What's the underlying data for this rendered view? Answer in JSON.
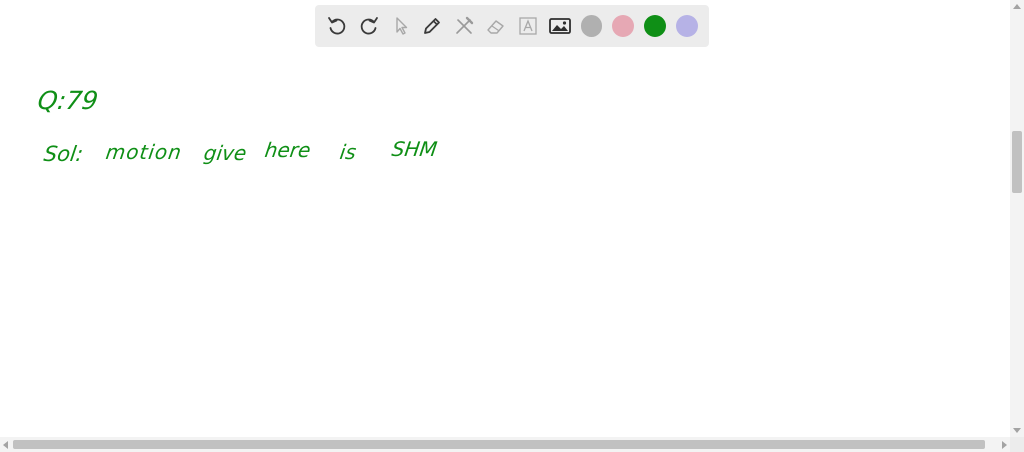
{
  "toolbar": {
    "tools": [
      {
        "name": "undo-icon"
      },
      {
        "name": "redo-icon"
      },
      {
        "name": "pointer-icon"
      },
      {
        "name": "pen-icon"
      },
      {
        "name": "tools-icon"
      },
      {
        "name": "eraser-icon"
      },
      {
        "name": "text-icon"
      },
      {
        "name": "image-icon"
      }
    ],
    "colors": [
      "#b0b0b0",
      "#e6a8b4",
      "#0f8f16",
      "#b6b2e6"
    ],
    "selected_color": "#0f8f16"
  },
  "notes": {
    "line1": "Q:79",
    "line2_label": "Sol:",
    "line2_words": [
      "motion",
      "give",
      "here",
      "is",
      "SHM"
    ]
  }
}
